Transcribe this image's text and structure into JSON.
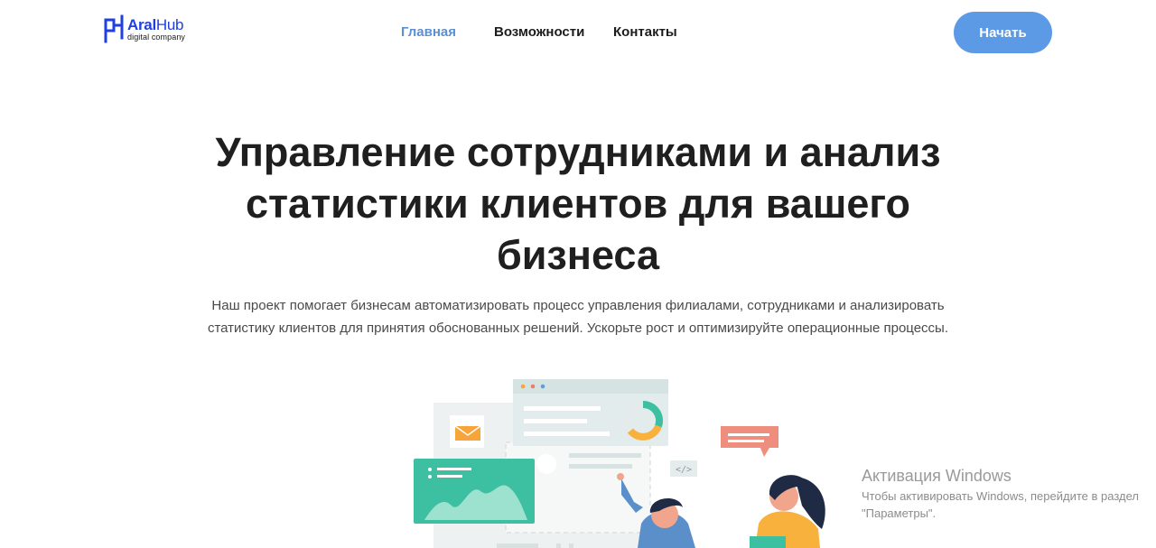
{
  "header": {
    "logo": {
      "name_bold": "Aral",
      "name_light": "Hub",
      "tagline": "digital company"
    },
    "nav": [
      {
        "label": "Главная",
        "active": true
      },
      {
        "label": "Возможности",
        "active": false
      },
      {
        "label": "Контакты",
        "active": false
      }
    ],
    "cta_label": "Начать"
  },
  "hero": {
    "title": "Управление сотрудниками и анализ статистики клиентов для вашего бизнеса",
    "subtitle": "Наш проект помогает бизнесам автоматизировать процесс управления филиалами, сотрудниками и анализировать статистику клиентов для принятия обоснованных решений. Ускорьте рост и оптимизируйте операционные процессы."
  },
  "illustration": {
    "code_tag": "</>"
  },
  "watermark": {
    "title": "Активация Windows",
    "desc": "Чтобы активировать Windows, перейдите в раздел \"Параметры\"."
  },
  "colors": {
    "brand": "#1f3fe0",
    "nav_active": "#5b8fd6",
    "button": "#5c9ae5",
    "teal": "#3dbfa1",
    "orange": "#f7b13c",
    "salmon": "#ef8d7f"
  }
}
